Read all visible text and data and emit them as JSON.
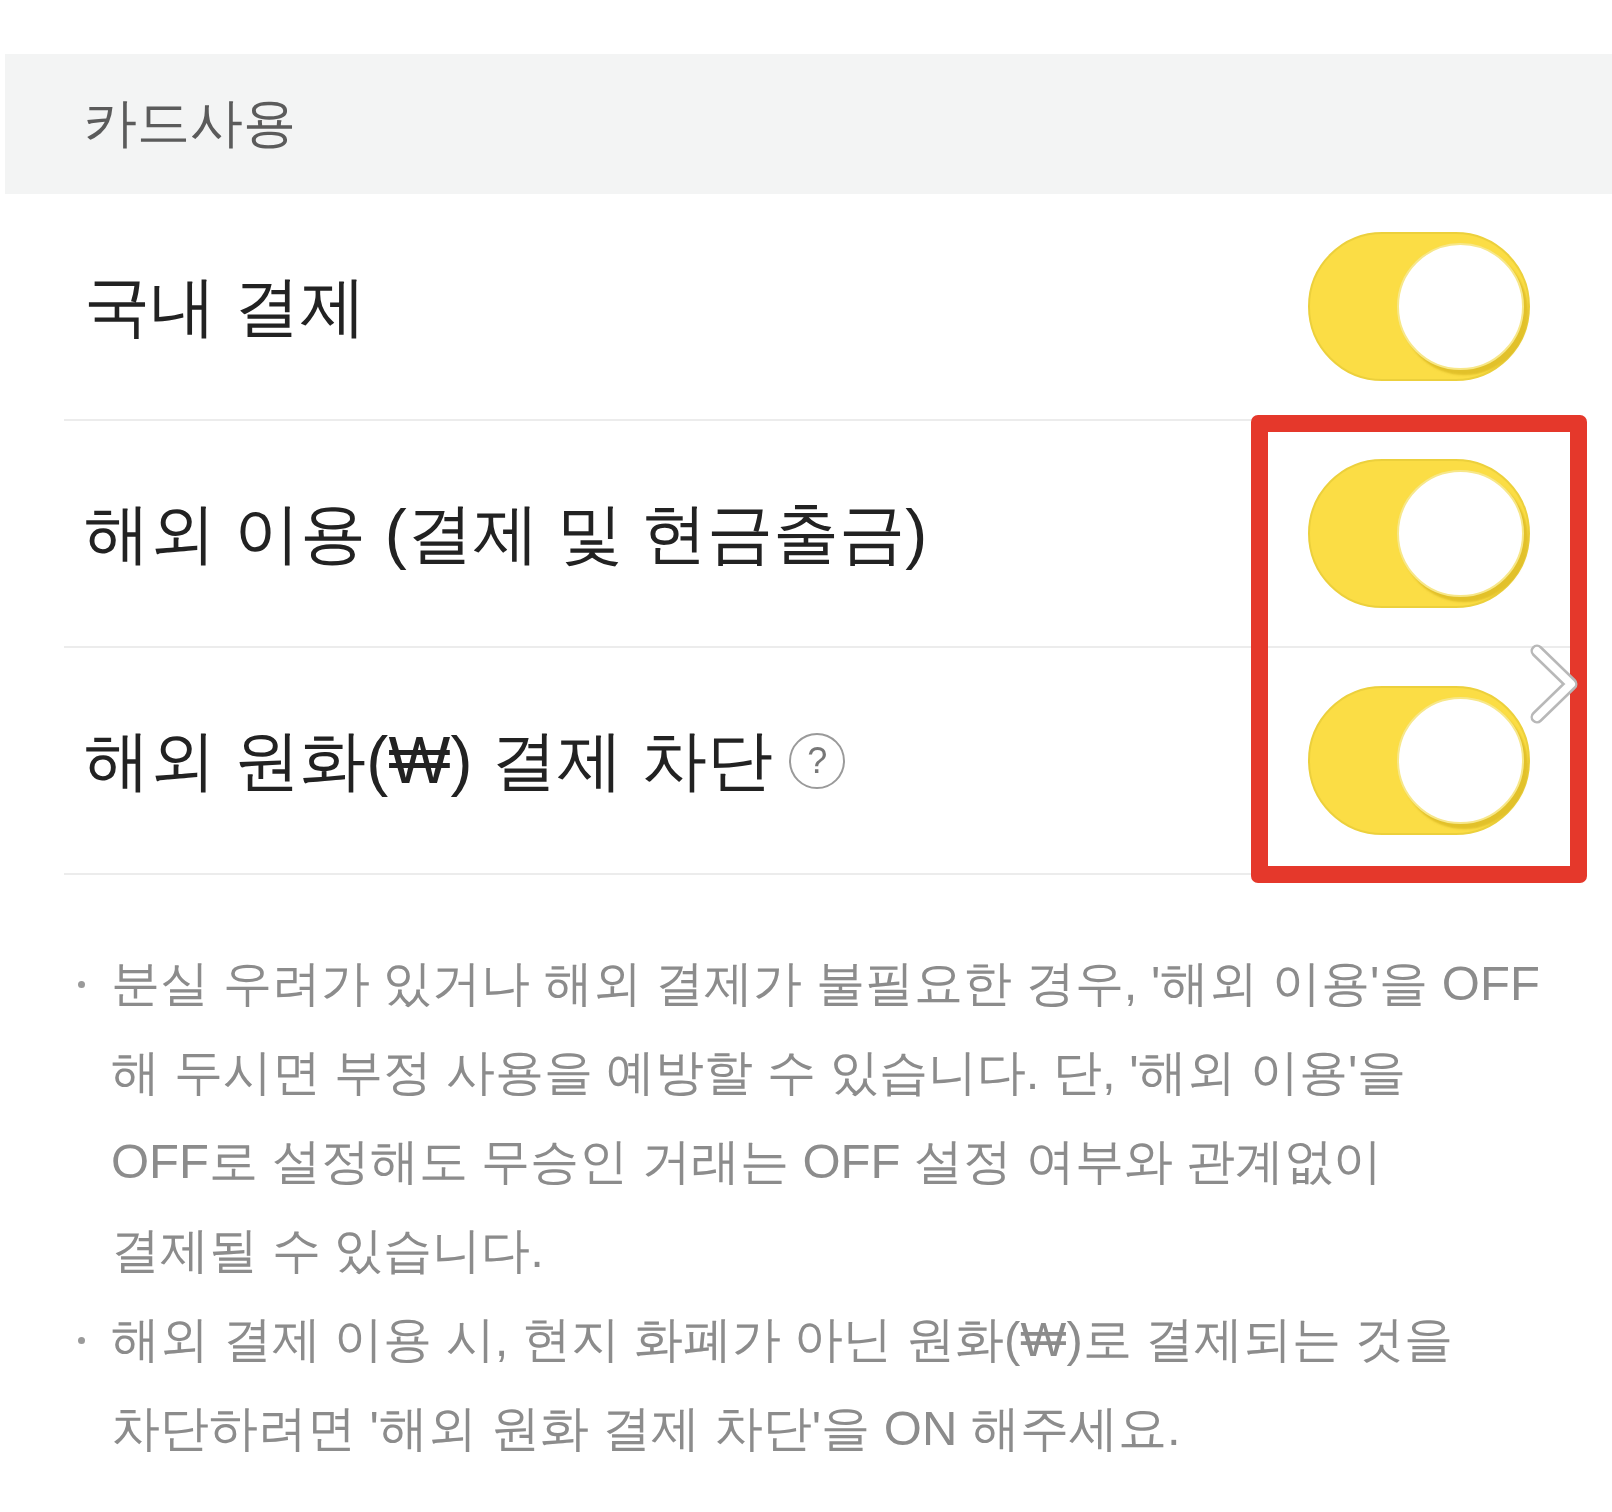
{
  "section_header": {
    "title": "카드사용"
  },
  "settings": [
    {
      "label": "국내 결제",
      "on": true,
      "highlighted": false
    },
    {
      "label": "해외 이용 (결제 및 현금출금)",
      "on": true,
      "highlighted": true
    },
    {
      "label": "해외 원화(₩) 결제 차단",
      "help": "?",
      "on": true,
      "highlighted": true
    }
  ],
  "notes": [
    "분실 우려가 있거나 해외 결제가 불필요한 경우, '해외 이용'을 OFF\n해 두시면 부정 사용을 예방할 수 있습니다. 단, '해외 이용'을\nOFF로 설정해도 무승인 거래는 OFF 설정 여부와 관계없이\n결제될 수 있습니다.",
    "해외 결제 이용 시, 현지 화폐가 아닌 원화(₩)로 결제되는 것을\n차단하려면 '해외 원화 결제 차단'을 ON 해주세요."
  ]
}
